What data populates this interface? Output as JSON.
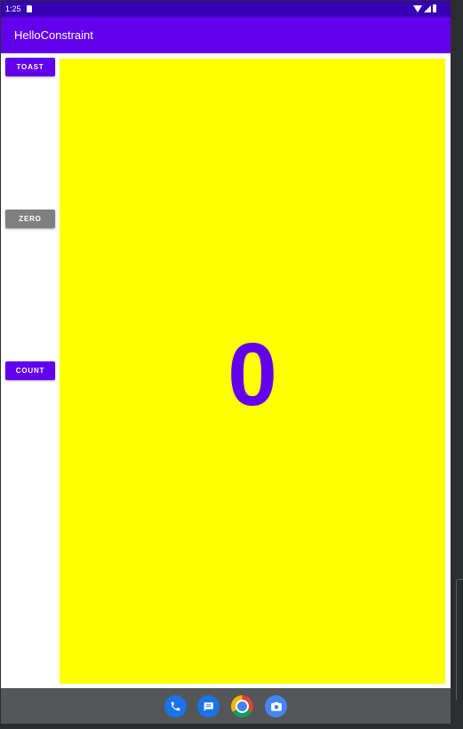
{
  "status_bar": {
    "time": "1:25",
    "icons": [
      "sd-card-icon",
      "wifi-icon",
      "signal-icon",
      "battery-icon"
    ]
  },
  "app_bar": {
    "title": "HelloConstraint"
  },
  "buttons": {
    "toast_label": "TOAST",
    "zero_label": "ZERO",
    "count_label": "COUNT"
  },
  "counter": {
    "value": "0"
  },
  "nav_bar": {
    "dock": [
      "phone-icon",
      "messages-icon",
      "chrome-icon",
      "camera-icon"
    ]
  },
  "colors": {
    "primary": "#6200ee",
    "primary_dark": "#3700b3",
    "zero_button": "#808080",
    "count_background": "#ffff00",
    "nav_bar": "#545657"
  }
}
